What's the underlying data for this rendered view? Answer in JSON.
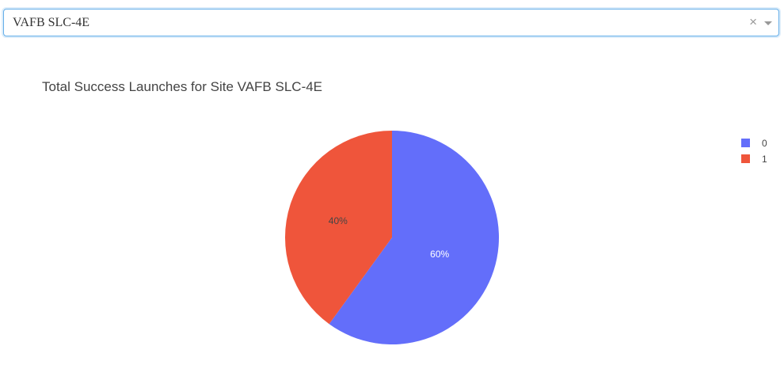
{
  "dropdown": {
    "selected": "VAFB SLC-4E",
    "clear_glyph": "×",
    "clear_icon": "close-icon",
    "arrow_icon": "chevron-down-icon"
  },
  "chart_data": {
    "type": "pie",
    "title": "Total Success Launches for Site VAFB SLC-4E",
    "labels": [
      "0",
      "1"
    ],
    "values": [
      60,
      40
    ],
    "text": [
      "60%",
      "40%"
    ],
    "colors": [
      "#636efa",
      "#ef553b"
    ],
    "text_colors": [
      "#ffffff",
      "#444444"
    ],
    "legend_position": "top-right",
    "sort": "descending",
    "direction": "clockwise"
  }
}
